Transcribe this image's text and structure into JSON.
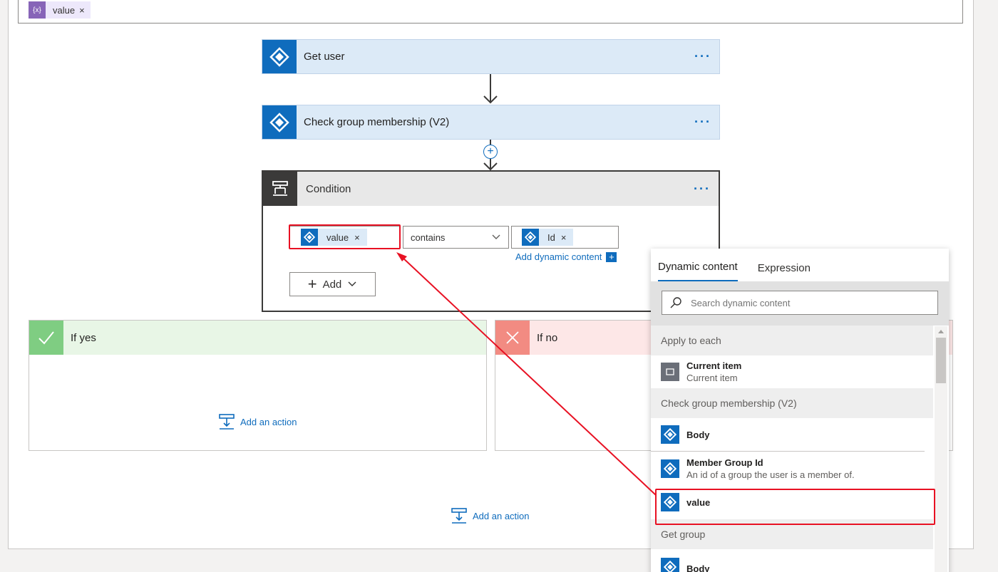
{
  "foreach": {
    "token_label": "value",
    "remove": "×"
  },
  "cards": [
    {
      "title": "Get user",
      "menu": "···"
    },
    {
      "title": "Check group membership (V2)",
      "menu": "···"
    }
  ],
  "condition": {
    "title": "Condition",
    "menu": "···",
    "left_token": "value",
    "remove": "×",
    "operator": "contains",
    "right_token": "Id",
    "add_dynamic": "Add dynamic content",
    "add_button": "Add"
  },
  "if_yes": {
    "title": "If yes",
    "add_action": "Add an action"
  },
  "if_no": {
    "title": "If no"
  },
  "bottom_add_action": "Add an action",
  "panel": {
    "tabs": [
      "Dynamic content",
      "Expression"
    ],
    "search_placeholder": "Search dynamic content",
    "sections": [
      {
        "title": "Apply to each"
      },
      {
        "title": "Check group membership (V2)"
      },
      {
        "title": "Get group"
      }
    ],
    "items": {
      "current_item": {
        "title": "Current item",
        "subtitle": "Current item"
      },
      "body": {
        "title": "Body"
      },
      "member_group_id": {
        "title": "Member Group Id",
        "subtitle": "An id of a group the user is a member of."
      },
      "value": {
        "title": "value"
      },
      "body2": {
        "title": "Body"
      }
    }
  },
  "colors": {
    "accent": "#0f6cbd",
    "highlight": "#e81123",
    "yes": "#7fcd82",
    "no": "#f28b82"
  }
}
